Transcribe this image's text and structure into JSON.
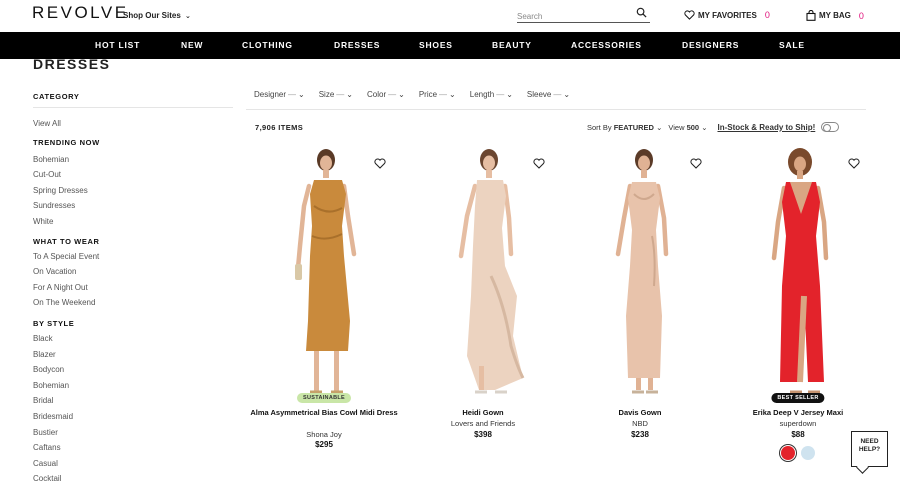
{
  "header": {
    "logo": "REVOLVE",
    "shop_sites": "Shop Our Sites",
    "search_placeholder": "Search",
    "favorites_label": "MY FAVORITES",
    "favorites_count": "0",
    "bag_label": "MY BAG",
    "bag_count": "0"
  },
  "nav": [
    "HOT LIST",
    "NEW",
    "CLOTHING",
    "DRESSES",
    "SHOES",
    "BEAUTY",
    "ACCESSORIES",
    "DESIGNERS",
    "SALE"
  ],
  "page_title": "DRESSES",
  "sidebar": {
    "category_heading": "CATEGORY",
    "view_all": "View All",
    "trending_heading": "TRENDING NOW",
    "trending": [
      "Bohemian",
      "Cut-Out",
      "Spring Dresses",
      "Sundresses",
      "White"
    ],
    "wear_heading": "WHAT TO WEAR",
    "wear": [
      "To A Special Event",
      "On Vacation",
      "For A Night Out",
      "On The Weekend"
    ],
    "style_heading": "BY STYLE",
    "styles": [
      "Black",
      "Blazer",
      "Bodycon",
      "Bohemian",
      "Bridal",
      "Bridesmaid",
      "Bustier",
      "Caftans",
      "Casual",
      "Cocktail"
    ]
  },
  "filters": [
    {
      "label": "Designer",
      "value": "—"
    },
    {
      "label": "Size",
      "value": "—"
    },
    {
      "label": "Color",
      "value": "—"
    },
    {
      "label": "Price",
      "value": "—"
    },
    {
      "label": "Length",
      "value": "—"
    },
    {
      "label": "Sleeve",
      "value": "—"
    }
  ],
  "toolbar": {
    "item_count": "7,906 ITEMS",
    "sort_label": "Sort By",
    "sort_value": "FEATURED",
    "view_label": "View",
    "view_value": "500",
    "instock_label": "In-Stock & Ready to Ship!"
  },
  "products": [
    {
      "name": "Alma Asymmetrical Bias Cowl Midi Dress",
      "brand": "Shona Joy",
      "price": "$295",
      "badge": "SUSTAINABLE",
      "dress_color": "#c98a3c"
    },
    {
      "name": "Heidi Gown",
      "brand": "Lovers and Friends",
      "price": "$398",
      "badge": "",
      "dress_color": "#ecd3c0"
    },
    {
      "name": "Davis Gown",
      "brand": "NBD",
      "price": "$238",
      "badge": "",
      "dress_color": "#e8c3ab"
    },
    {
      "name": "Erika Deep V Jersey Maxi",
      "brand": "superdown",
      "price": "$88",
      "badge": "BEST SELLER",
      "dress_color": "#e3232b"
    }
  ],
  "swatch_colors": [
    "#e3232b",
    "#cfe3ef"
  ],
  "help": {
    "line1": "NEED",
    "line2": "HELP?"
  }
}
